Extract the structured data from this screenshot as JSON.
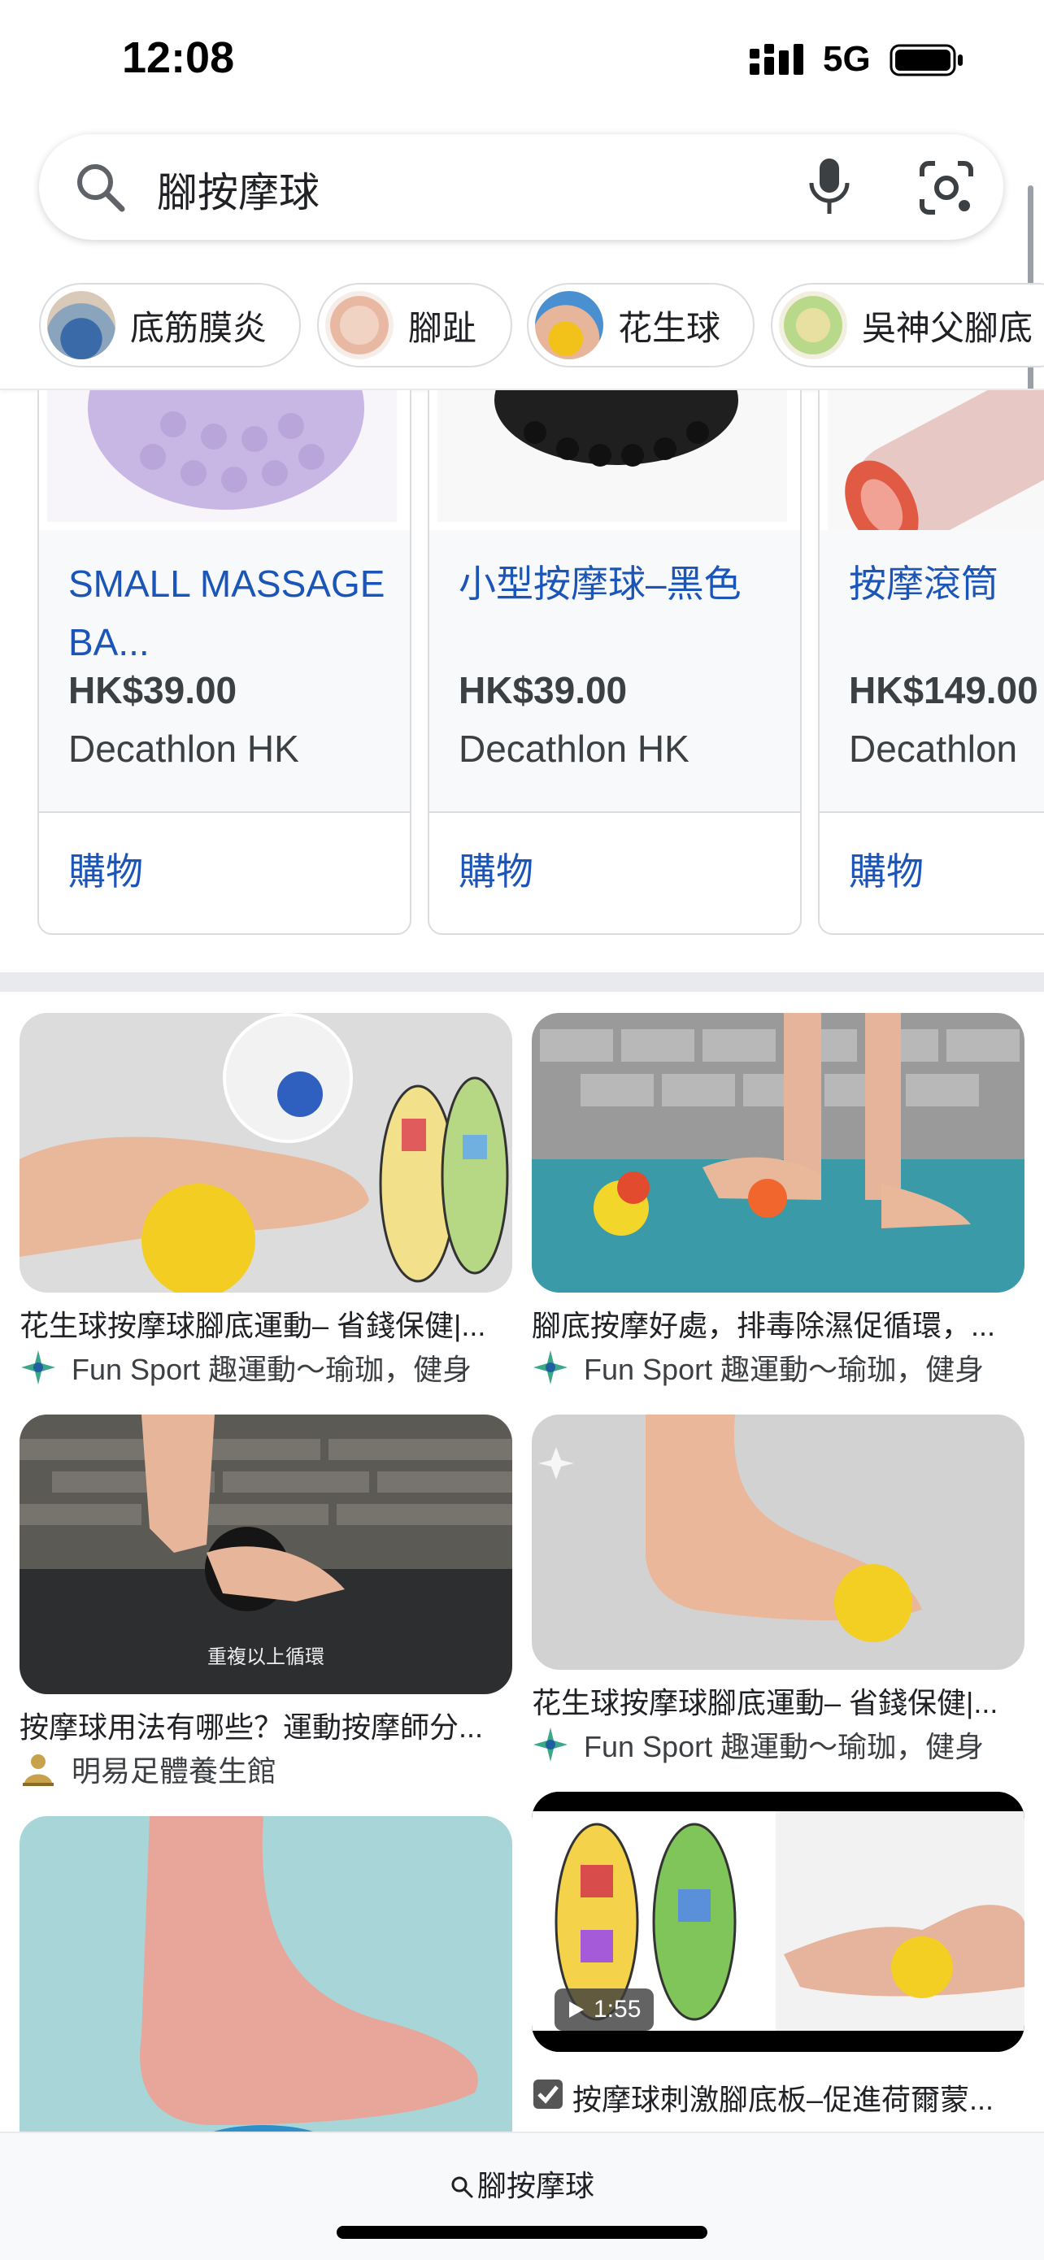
{
  "status": {
    "time": "12:08",
    "network": "5G"
  },
  "search": {
    "query": "腳按摩球"
  },
  "chips": [
    {
      "label": "底筋膜炎"
    },
    {
      "label": "腳趾"
    },
    {
      "label": "花生球"
    },
    {
      "label": "吳神父腳底"
    }
  ],
  "products": [
    {
      "title": "SMALL MASSAGE BA...",
      "price": "HK$39.00",
      "seller": "Decathlon HK",
      "action": "購物"
    },
    {
      "title": "小型按摩球–黑色",
      "price": "HK$39.00",
      "seller": "Decathlon HK",
      "action": "購物"
    },
    {
      "title": "按摩滾筒",
      "price": "HK$149.00",
      "seller": "Decathlon",
      "action": "購物"
    }
  ],
  "images": [
    {
      "caption": "花生球按摩球腳底運動– 省錢保健|...",
      "source": "Fun Sport 趣運動～瑜珈，健身"
    },
    {
      "caption": "腳底按摩好處，排毒除濕促循環，...",
      "source": "Fun Sport 趣運動～瑜珈，健身"
    },
    {
      "caption": "按摩球用法有哪些？運動按摩師分...",
      "source": "明易足體養生館",
      "overlay": "重複以上循環"
    },
    {
      "caption": "花生球按摩球腳底運動– 省錢保健|...",
      "source": "Fun Sport 趣運動～瑜珈，健身"
    },
    {
      "caption": "",
      "source": ""
    },
    {
      "caption": "按摩球刺激腳底板–促進荷爾蒙...",
      "source": "",
      "duration": "1:55"
    }
  ],
  "bottom": {
    "query": "腳按摩球"
  }
}
